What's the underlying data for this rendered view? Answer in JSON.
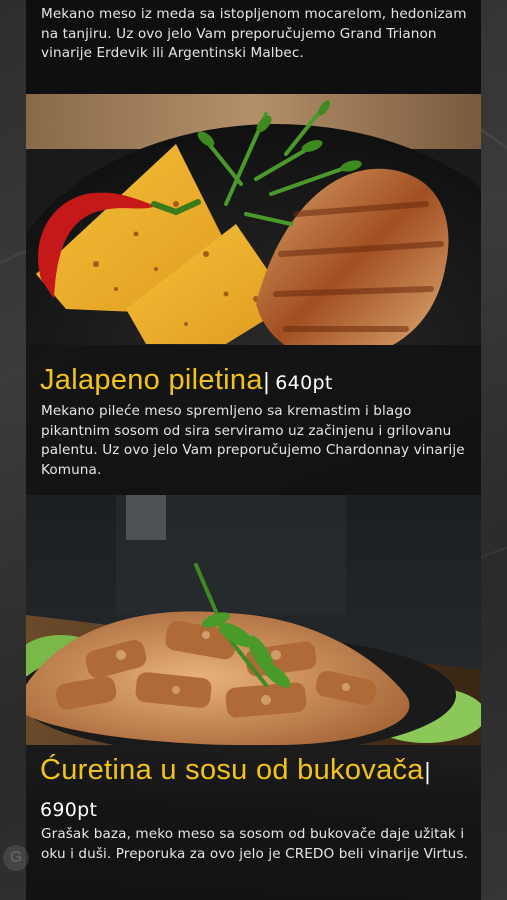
{
  "colors": {
    "accent": "#f2c318",
    "card_bg": "#0f0f0f",
    "text": "#e6e6e6",
    "page_bg": "#333333"
  },
  "items": [
    {
      "description": "Mekano meso iz meda sa istopljenom mocarelom, hedonizam na tanjiru. Uz ovo jelo Vam preporučujemo Grand Trianon vinarije Erdevik ili Argentinski Malbec."
    },
    {
      "image": "jalapeno-chicken-photo",
      "title": "Jalapeno piletina",
      "separator": "|",
      "price": "640pt",
      "description": "Mekano pileće meso spremljeno sa kremastim i blago pikantnim sosom od sira serviramo uz začinjenu i grilovanu palentu. Uz ovo jelo Vam preporučujemo Chardonnay vinarije Komuna."
    },
    {
      "image": "chicken-mushroom-sauce-photo",
      "title": "Ćuretina u sosu od bukovača",
      "separator": "|",
      "price": "690pt",
      "description": "Grašak baza, meko meso sa sosom od bukovače daje užitak i oku i duši. Preporuka za ovo jelo je CREDO beli vinarije Virtus."
    }
  ],
  "badge": {
    "icon": "google-icon",
    "glyph": "G"
  }
}
